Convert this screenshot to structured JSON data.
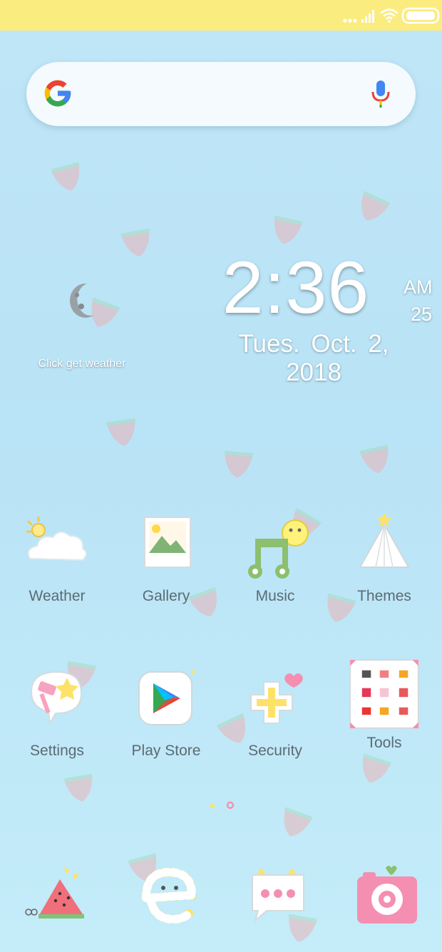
{
  "statusbar": {
    "icons": [
      "dots-icon",
      "signal-icon",
      "wifi-icon",
      "battery-icon"
    ]
  },
  "search": {
    "icons": [
      "google-g-icon",
      "microphone-icon"
    ]
  },
  "clock": {
    "time": "2:36",
    "ampm": "AM",
    "seconds": "25",
    "date": "Tues.  Oct. 2,  2018"
  },
  "weather_widget": {
    "hint": "Click get weather",
    "icon": "moon-icon"
  },
  "apps_row1": [
    {
      "label": "Weather",
      "icon": "weather-cloud-icon"
    },
    {
      "label": "Gallery",
      "icon": "gallery-photo-icon"
    },
    {
      "label": "Music",
      "icon": "music-note-icon"
    },
    {
      "label": "Themes",
      "icon": "tent-icon"
    }
  ],
  "apps_row2": [
    {
      "label": "Settings",
      "icon": "settings-hammer-star-icon"
    },
    {
      "label": "Play Store",
      "icon": "play-store-icon"
    },
    {
      "label": "Security",
      "icon": "security-plus-icon"
    },
    {
      "label": "Tools",
      "icon": "tools-grid-icon"
    }
  ],
  "dock": [
    "watermelon-icon",
    "browser-e-icon",
    "messages-bubble-icon",
    "camera-icon"
  ],
  "colors": {
    "statusbar": "#fbec7f",
    "wallpaper": "#bfe6f7",
    "label": "#5b6b72"
  }
}
